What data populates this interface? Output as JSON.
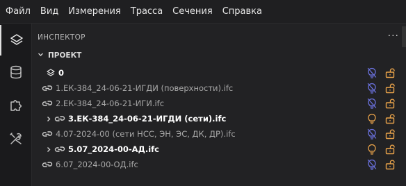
{
  "menu": {
    "items": [
      "Файл",
      "Вид",
      "Измерения",
      "Трасса",
      "Сечения",
      "Справка"
    ]
  },
  "activity_bar": {
    "items": [
      {
        "icon": "layers-icon",
        "active": true
      },
      {
        "icon": "database-icon",
        "active": false
      },
      {
        "icon": "puzzle-icon",
        "active": false
      },
      {
        "icon": "tools-icon",
        "active": false
      }
    ]
  },
  "inspector": {
    "title": "ИНСПЕКТОР",
    "more": "···",
    "section_title": "ПРОЕКТ",
    "rows": [
      {
        "label": "0",
        "icon": "layers-icon",
        "expandable": false,
        "style": "bold",
        "bulb": "off",
        "lock": "unlocked"
      },
      {
        "label": "1.ЕК-384_24-06-21-ИГДИ (поверхности).ifc",
        "icon": "link-icon",
        "expandable": false,
        "style": "dim",
        "bulb": "off",
        "lock": "unlocked"
      },
      {
        "label": "2.ЕК-384_24-06-21-ИГИ.ifc",
        "icon": "link-icon",
        "expandable": false,
        "style": "dim",
        "bulb": "off",
        "lock": "unlocked"
      },
      {
        "label": "3.ЕК-384_24-06-21-ИГДИ (сети).ifc",
        "icon": "link-icon",
        "expandable": true,
        "style": "bold",
        "bulb": "on",
        "lock": "unlocked"
      },
      {
        "label": "4.07-2024-00 (сети НСС, ЭН, ЭС, ДК, ДР).ifc",
        "icon": "link-icon",
        "expandable": false,
        "style": "dim",
        "bulb": "off",
        "lock": "unlocked"
      },
      {
        "label": "5.07_2024-00-АД.ifc",
        "icon": "link-icon",
        "expandable": true,
        "style": "bold",
        "bulb": "on",
        "lock": "unlocked"
      },
      {
        "label": "6.07_2024-00-ОД.ifc",
        "icon": "link-icon",
        "expandable": false,
        "style": "dim",
        "bulb": "off",
        "lock": "unlocked"
      }
    ]
  },
  "colors": {
    "bulb_off": "#6b72e0",
    "bulb_on": "#e8a24a",
    "lock": "#e8a24a"
  }
}
